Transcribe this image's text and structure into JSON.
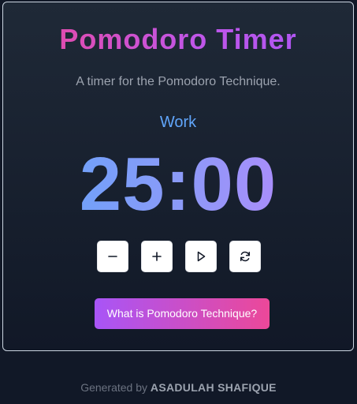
{
  "app": {
    "title": "Pomodoro Timer",
    "subtitle": "A timer for the Pomodoro Technique."
  },
  "timer": {
    "mode": "Work",
    "time": "25:00"
  },
  "controls": [
    {
      "name": "decrease",
      "icon": "minus-icon"
    },
    {
      "name": "increase",
      "icon": "plus-icon"
    },
    {
      "name": "start",
      "icon": "play-icon"
    },
    {
      "name": "reset",
      "icon": "reset-icon"
    }
  ],
  "info_button": {
    "label": "What is Pomodoro Technique?"
  },
  "footer": {
    "prefix": "Generated by",
    "author": "ASADULAH SHAFIQUE"
  },
  "colors": {
    "background": "#111827",
    "title_gradient_start": "#ec4899",
    "title_gradient_end": "#a855f7",
    "mode": "#60a5fa",
    "time_gradient_start": "#60a5fa",
    "time_gradient_end": "#c084fc",
    "button_gradient_start": "#a855f7",
    "button_gradient_end": "#ec4899"
  }
}
